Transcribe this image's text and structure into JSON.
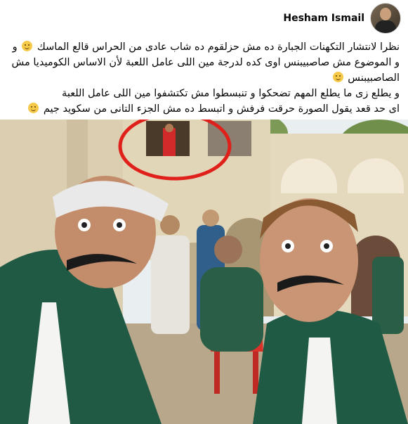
{
  "post": {
    "author": "Hesham Ismail",
    "lines": [
      "نظرا لانتشار التكهنات الجبارة  ده مش حزلقوم ده شاب عادى من الحراس قالع الماسك",
      "و الموضوع مش صاصبيبنس اوى كده لدرجة مين اللى عامل اللعبة لأن الاساس الكوميديا مش الصاصبيبنس",
      "و يطلع زى ما يطلع المهم تضحكوا و تنبسطوا مش تكتشفوا مين اللى عامل اللعبة",
      "اى حد قعد يقول الصورة حرقت  فرفش و اتبسط ده مش الجزء التانى من سكويد جيم"
    ],
    "emoji": [
      "grinning-emoji",
      "grinning-emoji",
      "relieved-emoji",
      "grinning-emoji"
    ]
  },
  "photo": {
    "subject": "two men in green tracksuits with fake mustaches, one guard in red circled in background",
    "colors": {
      "tracksuit": "#1f5a45",
      "circle": "#e0201a",
      "wall": "#d6c9aa",
      "sky": "#eef2f5"
    }
  }
}
